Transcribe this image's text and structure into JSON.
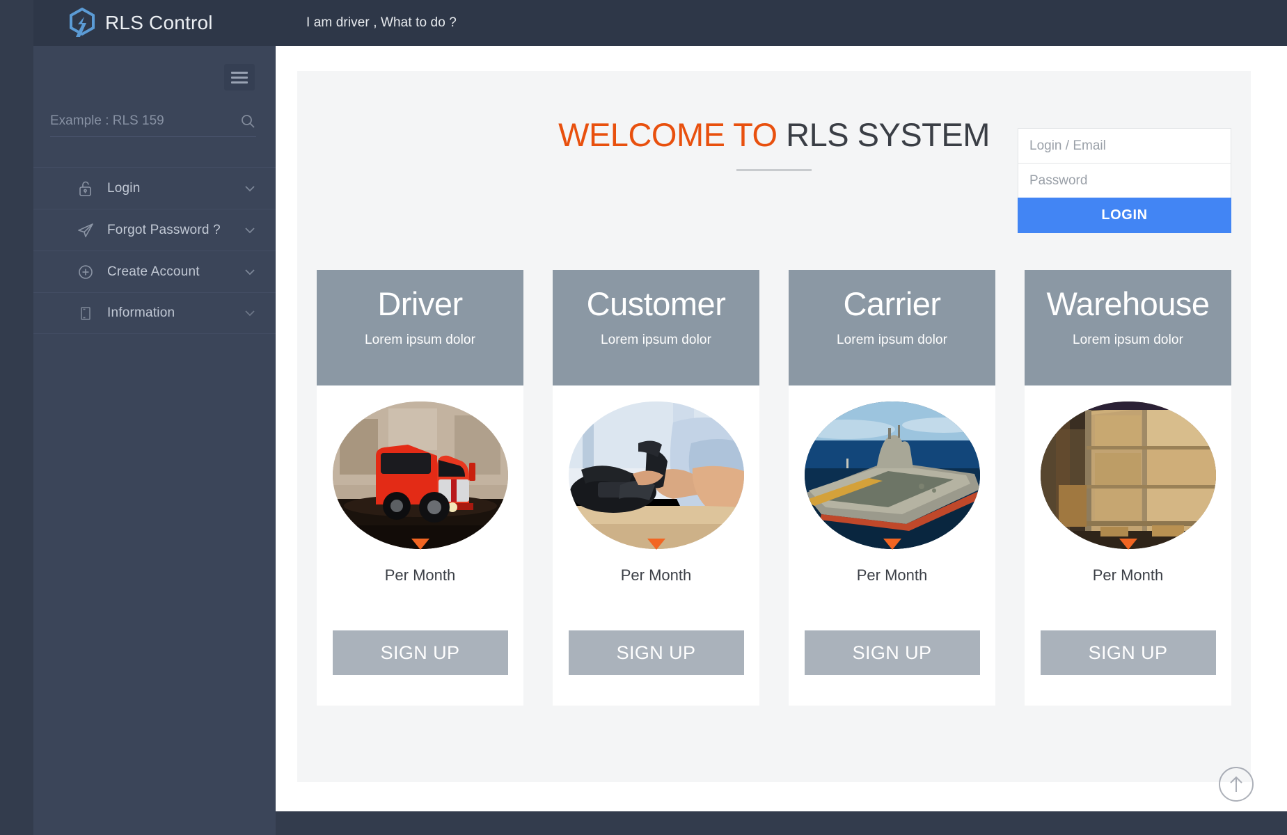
{
  "topbar": {
    "brand_name": "RLS Control",
    "logo_icon": "rls-hexagon-logo-icon",
    "question": "I am driver , What to do ?"
  },
  "sidebar": {
    "menu_toggle_icon": "hamburger-menu-icon",
    "search": {
      "placeholder": "Example : RLS 159",
      "value": "",
      "icon": "search-icon"
    },
    "items": [
      {
        "label": "Login",
        "icon": "unlock-padlock-icon",
        "chevron": "chevron-down-icon"
      },
      {
        "label": "Forgot Password ?",
        "icon": "paper-plane-icon",
        "chevron": "chevron-down-icon"
      },
      {
        "label": "Create Account",
        "icon": "plus-circle-icon",
        "chevron": "chevron-down-icon"
      },
      {
        "label": "Information",
        "icon": "document-page-icon",
        "chevron": "chevron-down-icon"
      }
    ]
  },
  "main": {
    "title_accent": "WELCOME TO",
    "title_plain": "RLS SYSTEM",
    "accent_color": "#e8500e",
    "cards": [
      {
        "title": "Driver",
        "subtitle": "Lorem ipsum dolor",
        "image": "red-semi-truck-photo",
        "price_label": "Per Month",
        "signup_label": "SIGN UP"
      },
      {
        "title": "Customer",
        "subtitle": "Lorem ipsum dolor",
        "image": "hand-dialing-office-phone-photo",
        "price_label": "Per Month",
        "signup_label": "SIGN UP"
      },
      {
        "title": "Carrier",
        "subtitle": "Lorem ipsum dolor",
        "image": "aircraft-carrier-ship-photo",
        "price_label": "Per Month",
        "signup_label": "SIGN UP"
      },
      {
        "title": "Warehouse",
        "subtitle": "Lorem ipsum dolor",
        "image": "warehouse-cardboard-boxes-photo",
        "price_label": "Per Month",
        "signup_label": "SIGN UP"
      }
    ]
  },
  "login": {
    "email_placeholder": "Login / Email",
    "email_value": "",
    "password_placeholder": "Password",
    "password_value": "",
    "submit_label": "LOGIN",
    "button_color": "#4285f4"
  },
  "footer": {
    "scroll_top_icon": "arrow-up-circle-icon"
  }
}
